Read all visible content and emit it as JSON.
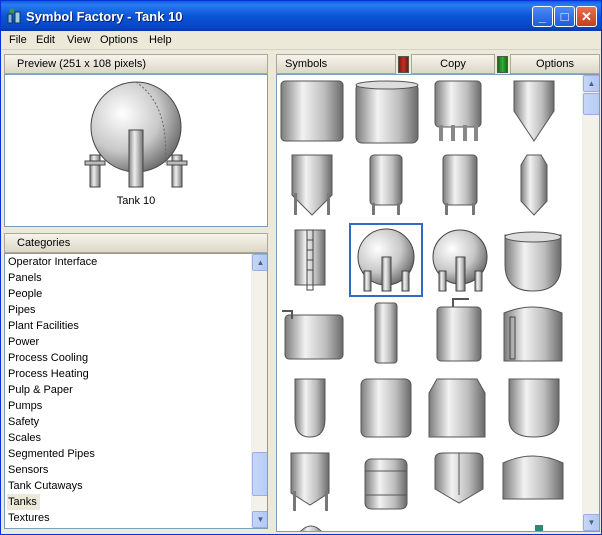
{
  "window": {
    "title": "Symbol Factory - Tank 10",
    "minimize": "_",
    "maximize": "□",
    "close": "✕"
  },
  "menu": [
    "File",
    "Edit",
    "View",
    "Options",
    "Help"
  ],
  "preview": {
    "header": "Preview (251 x 108 pixels)",
    "caption": "Tank 10"
  },
  "categories": {
    "header": "Categories",
    "items": [
      "Operator Interface",
      "Panels",
      "People",
      "Pipes",
      "Plant Facilities",
      "Power",
      "Process Cooling",
      "Process Heating",
      "Pulp & Paper",
      "Pumps",
      "Safety",
      "Scales",
      "Segmented Pipes",
      "Sensors",
      "Tank Cutaways",
      "Tanks",
      "Textures"
    ],
    "selected": "Tanks"
  },
  "symbols": {
    "header": "Symbols",
    "copy_label": "Copy",
    "options_label": "Options",
    "selected_index": 9
  },
  "colors": {
    "selection_border": "#316ac5",
    "led_red": "#c03020",
    "led_green": "#30b030"
  }
}
